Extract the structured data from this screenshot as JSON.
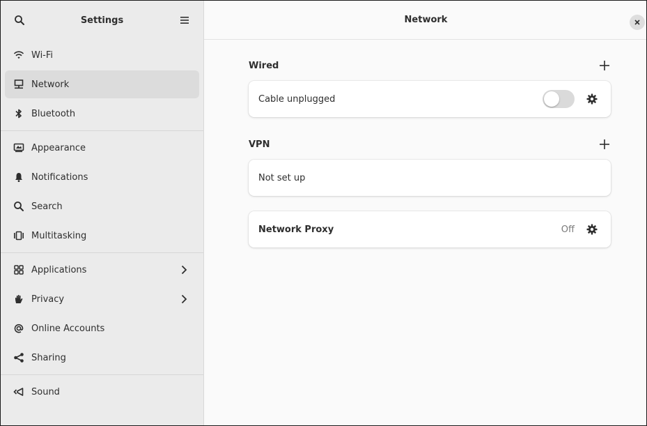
{
  "sidebar": {
    "title": "Settings",
    "search_icon": "search-icon",
    "menu_icon": "hamburger-menu-icon",
    "groups": [
      [
        {
          "label": "Wi-Fi",
          "icon": "wifi-icon",
          "active": false
        },
        {
          "label": "Network",
          "icon": "network-icon",
          "active": true
        },
        {
          "label": "Bluetooth",
          "icon": "bluetooth-icon",
          "active": false
        }
      ],
      [
        {
          "label": "Appearance",
          "icon": "appearance-icon",
          "active": false
        },
        {
          "label": "Notifications",
          "icon": "bell-icon",
          "active": false
        },
        {
          "label": "Search",
          "icon": "search-icon",
          "active": false
        },
        {
          "label": "Multitasking",
          "icon": "multitasking-icon",
          "active": false
        }
      ],
      [
        {
          "label": "Applications",
          "icon": "applications-icon",
          "active": false,
          "chevron": true
        },
        {
          "label": "Privacy",
          "icon": "hand-icon",
          "active": false,
          "chevron": true
        },
        {
          "label": "Online Accounts",
          "icon": "at-icon",
          "active": false
        },
        {
          "label": "Sharing",
          "icon": "share-icon",
          "active": false
        }
      ],
      [
        {
          "label": "Sound",
          "icon": "speaker-icon",
          "active": false
        }
      ]
    ]
  },
  "main": {
    "title": "Network",
    "wired": {
      "title": "Wired",
      "row_label": "Cable unplugged",
      "toggle_on": false
    },
    "vpn": {
      "title": "VPN",
      "row_label": "Not set up"
    },
    "proxy": {
      "label": "Network Proxy",
      "status": "Off"
    }
  },
  "colors": {
    "sidebar_bg": "#ebebeb",
    "active_item_bg": "#dcdcdc",
    "main_bg": "#fafafa",
    "card_bg": "#ffffff",
    "text": "#2e2e2e"
  }
}
